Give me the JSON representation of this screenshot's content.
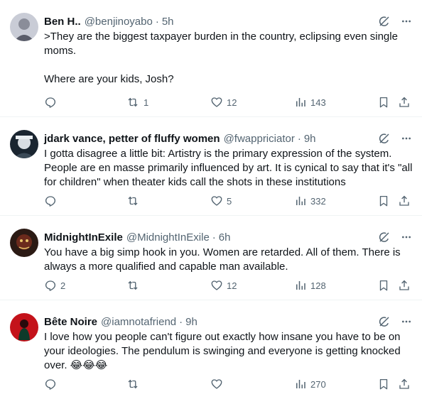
{
  "tweets": [
    {
      "name": "Ben H..",
      "handle": "@benjinoyabo",
      "time": "5h",
      "text": ">They are the biggest taxpayer burden in the country, eclipsing even single moms.\n\nWhere are your kids, Josh?",
      "replies": "",
      "reposts": "1",
      "likes": "12",
      "views": "143",
      "avatar_color": "#c9ccd6"
    },
    {
      "name": "jdark vance, petter of fluffy women",
      "handle": "@fwappriciator",
      "time": "9h",
      "text": "I gotta disagree a little bit: Artistry is the primary expression of the system. People are en masse primarily influenced by art. It is cynical to say that it's \"all for children\" when theater kids call the shots in these institutions",
      "replies": "",
      "reposts": "",
      "likes": "5",
      "views": "332",
      "avatar_color": "#1a2530"
    },
    {
      "name": "MidnightInExile",
      "handle": "@MidnightInExile",
      "time": "6h",
      "text": "You have a big simp hook in you. Women are retarded. All of them. There is always a more qualified and capable man available.",
      "replies": "2",
      "reposts": "",
      "likes": "12",
      "views": "128",
      "avatar_color": "#6b2a1c"
    },
    {
      "name": "Bête Noire",
      "handle": "@iamnotafriend",
      "time": "9h",
      "text": "I love how you people can't figure out exactly how insane you have to be on your ideologies. The pendulum is swinging and everyone is getting knocked over. 😂😂😂",
      "replies": "",
      "reposts": "",
      "likes": "",
      "views": "270",
      "avatar_color": "#c4121a"
    }
  ],
  "colors": {
    "text": "#0f1419",
    "muted": "#536471",
    "border": "#eff3f4"
  }
}
